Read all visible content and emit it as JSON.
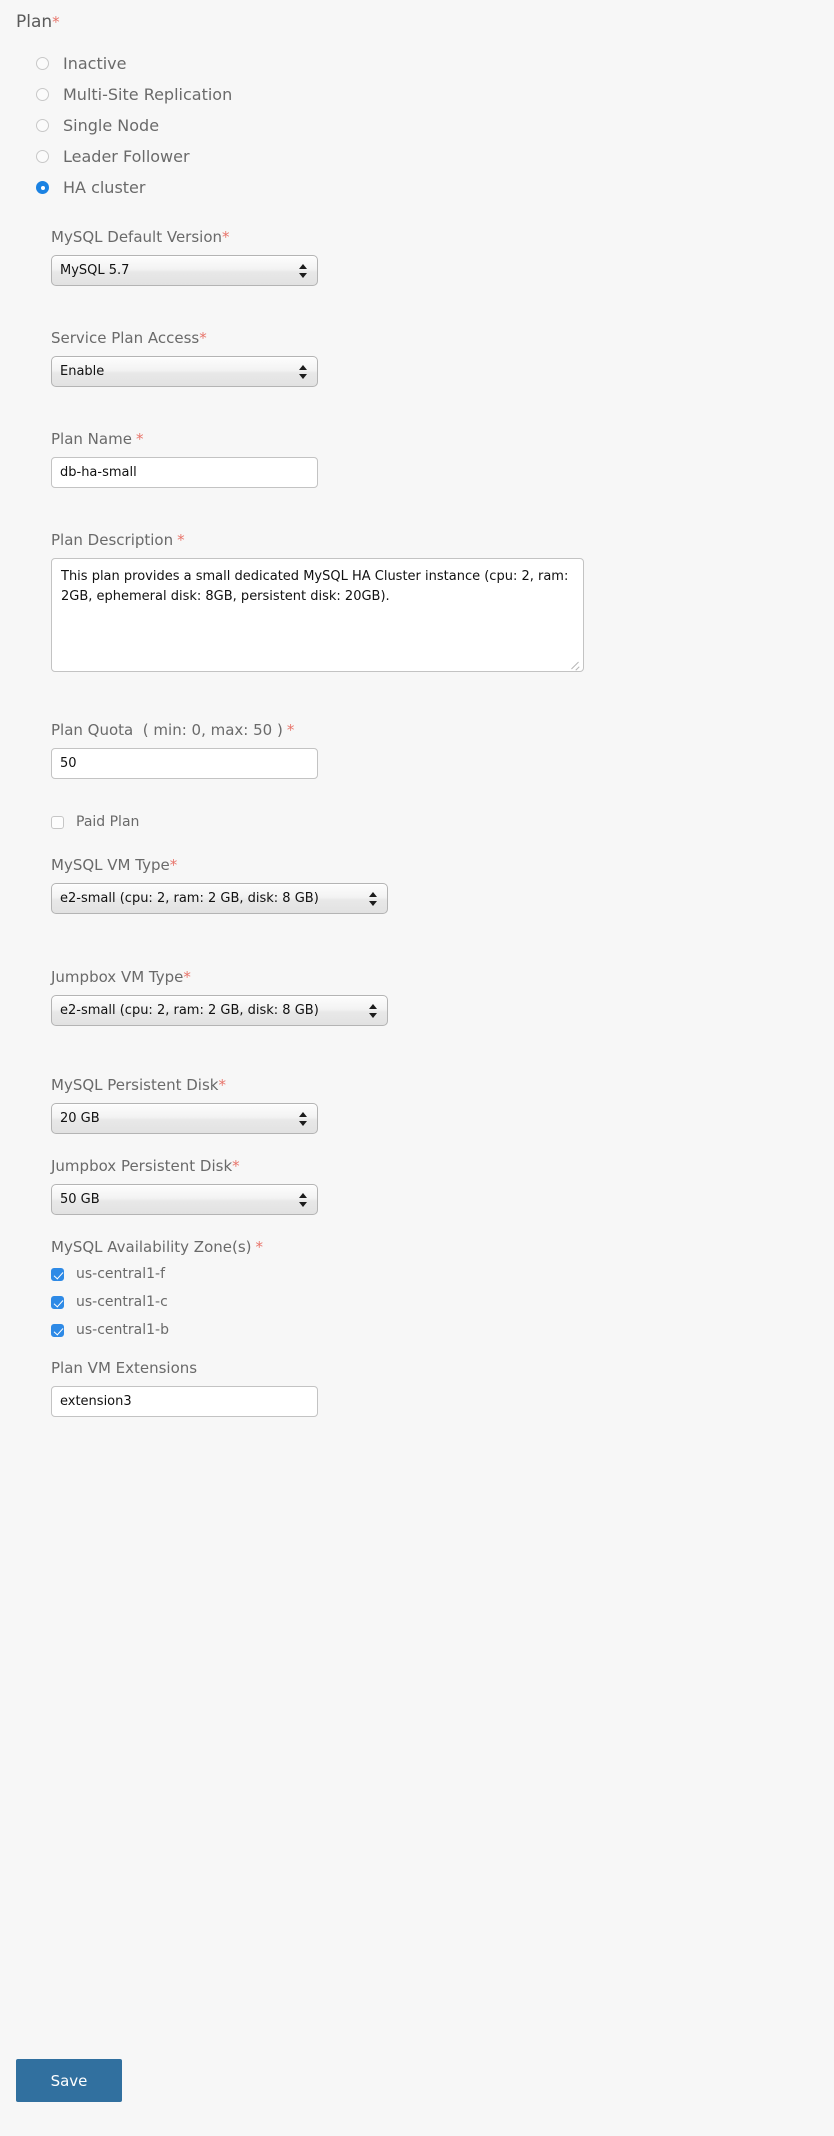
{
  "form": {
    "group_label": "Plan",
    "required_mark": "*",
    "plan_options": [
      {
        "label": "Inactive",
        "selected": false
      },
      {
        "label": "Multi-Site Replication",
        "selected": false
      },
      {
        "label": "Single Node",
        "selected": false
      },
      {
        "label": "Leader Follower",
        "selected": false
      },
      {
        "label": "HA cluster",
        "selected": true
      }
    ],
    "mysql_default_version": {
      "label": "MySQL Default Version",
      "value": "MySQL 5.7",
      "required": true
    },
    "service_plan_access": {
      "label": "Service Plan Access",
      "value": "Enable",
      "required": true
    },
    "plan_name": {
      "label": "Plan Name",
      "value": "db-ha-small",
      "required": true
    },
    "plan_description": {
      "label": "Plan Description",
      "value": "This plan provides a small dedicated MySQL HA Cluster instance (cpu: 2, ram: 2GB, ephemeral disk: 8GB, persistent disk: 20GB).",
      "required": true
    },
    "plan_quota": {
      "label": "Plan Quota",
      "hint": "( min: 0, max: 50 )",
      "value": "50",
      "required": true
    },
    "paid_plan": {
      "label": "Paid Plan",
      "checked": false
    },
    "mysql_vm_type": {
      "label": "MySQL VM Type",
      "value": "e2-small (cpu: 2, ram: 2 GB, disk: 8 GB)",
      "required": true
    },
    "jumpbox_vm_type": {
      "label": "Jumpbox VM Type",
      "value": "e2-small (cpu: 2, ram: 2 GB, disk: 8 GB)",
      "required": true
    },
    "mysql_persistent_disk": {
      "label": "MySQL Persistent Disk",
      "value": "20 GB",
      "required": true
    },
    "jumpbox_persistent_disk": {
      "label": "Jumpbox Persistent Disk",
      "value": "50 GB",
      "required": true
    },
    "availability_zones": {
      "label": "MySQL Availability Zone(s)",
      "required": true,
      "zones": [
        {
          "label": "us-central1-f",
          "checked": true
        },
        {
          "label": "us-central1-c",
          "checked": true
        },
        {
          "label": "us-central1-b",
          "checked": true
        }
      ]
    },
    "plan_vm_extensions": {
      "label": "Plan VM Extensions",
      "value": "extension3",
      "required": false
    },
    "save_label": "Save"
  },
  "colors": {
    "accent_blue": "#1b82e2",
    "checkbox_blue": "#2e8ae6",
    "save_button": "#31709f",
    "required_red": "#e8756b",
    "page_background": "#f7f7f7"
  }
}
